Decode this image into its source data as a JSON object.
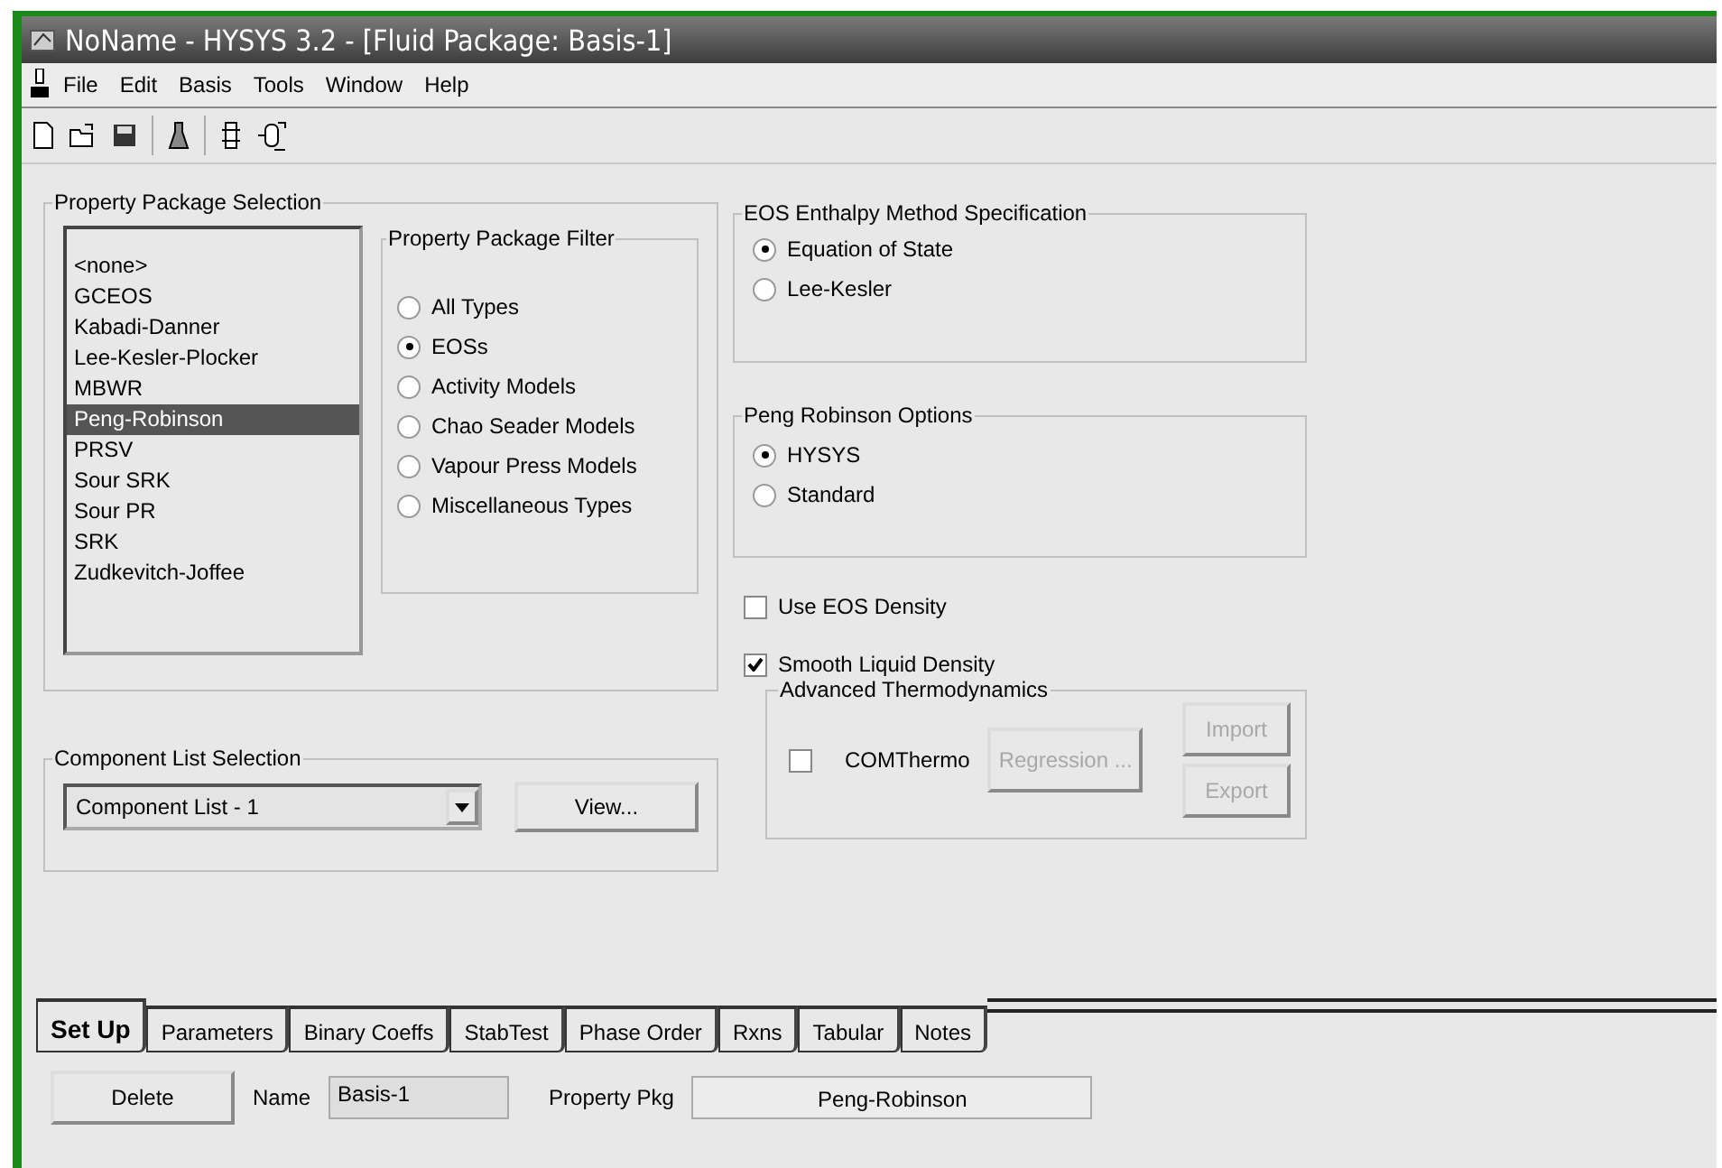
{
  "window": {
    "title": "NoName - HYSYS 3.2 - [Fluid Package: Basis-1]"
  },
  "menu": [
    "File",
    "Edit",
    "Basis",
    "Tools",
    "Window",
    "Help"
  ],
  "package_selection": {
    "title": "Property Package Selection",
    "items": [
      {
        "label": "<none>",
        "selected": false
      },
      {
        "label": "GCEOS",
        "selected": false
      },
      {
        "label": "Kabadi-Danner",
        "selected": false
      },
      {
        "label": "Lee-Kesler-Plocker",
        "selected": false
      },
      {
        "label": "MBWR",
        "selected": false
      },
      {
        "label": "Peng-Robinson",
        "selected": true
      },
      {
        "label": "PRSV",
        "selected": false
      },
      {
        "label": "Sour SRK",
        "selected": false
      },
      {
        "label": "Sour PR",
        "selected": false
      },
      {
        "label": "SRK",
        "selected": false
      },
      {
        "label": "Zudkevitch-Joffee",
        "selected": false
      }
    ]
  },
  "package_filter": {
    "title": "Property Package Filter",
    "options": [
      {
        "label": "All Types",
        "selected": false
      },
      {
        "label": "EOSs",
        "selected": true
      },
      {
        "label": "Activity Models",
        "selected": false
      },
      {
        "label": "Chao Seader Models",
        "selected": false
      },
      {
        "label": "Vapour Press Models",
        "selected": false
      },
      {
        "label": "Miscellaneous Types",
        "selected": false
      }
    ]
  },
  "component_list": {
    "title": "Component List Selection",
    "value": "Component List - 1",
    "button": "View..."
  },
  "eos_enthalpy": {
    "title": "EOS Enthalpy Method Specification",
    "options": [
      {
        "label": "Equation of State",
        "selected": true
      },
      {
        "label": "Lee-Kesler",
        "selected": false
      }
    ]
  },
  "peng_robinson_options": {
    "title": "Peng Robinson Options",
    "options": [
      {
        "label": "HYSYS",
        "selected": true
      },
      {
        "label": "Standard",
        "selected": false
      }
    ]
  },
  "checkboxes": [
    {
      "label": "Use EOS Density",
      "checked": false
    },
    {
      "label": "Smooth Liquid Density",
      "checked": true
    }
  ],
  "advanced": {
    "title": "Advanced Thermodynamics",
    "comthermo": {
      "label": "COMThermo",
      "checked": false
    },
    "buttons": [
      {
        "label": "Regression ...",
        "disabled": true
      },
      {
        "label": "Import",
        "disabled": true
      },
      {
        "label": "Export",
        "disabled": true
      }
    ]
  },
  "tabs": [
    {
      "label": "Set Up",
      "selected": true
    },
    {
      "label": "Parameters",
      "selected": false
    },
    {
      "label": "Binary Coeffs",
      "selected": false
    },
    {
      "label": "StabTest",
      "selected": false
    },
    {
      "label": "Phase Order",
      "selected": false
    },
    {
      "label": "Rxns",
      "selected": false
    },
    {
      "label": "Tabular",
      "selected": false
    },
    {
      "label": "Notes",
      "selected": false
    }
  ],
  "footer": {
    "delete_button": "Delete",
    "name_label": "Name",
    "name_value": "Basis-1",
    "package_label": "Property Pkg",
    "package_value": "Peng-Robinson"
  }
}
